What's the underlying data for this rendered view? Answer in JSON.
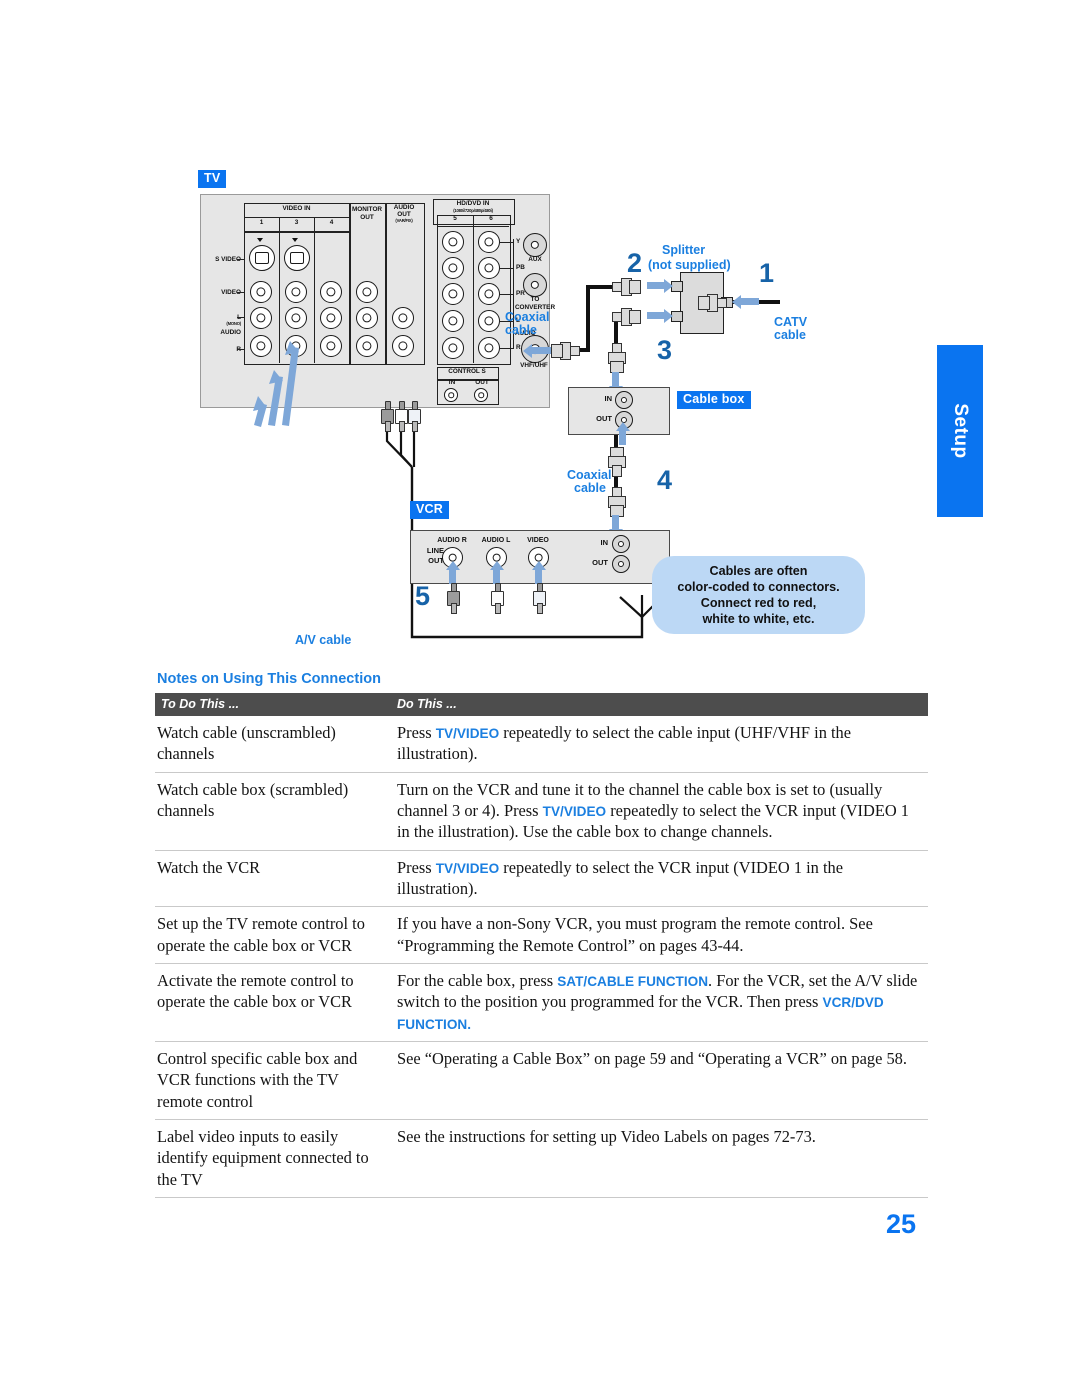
{
  "page": {
    "number": "25",
    "side_tab": "Setup"
  },
  "diagram": {
    "device_labels": {
      "tv": "TV",
      "cable_box": "Cable box",
      "vcr": "VCR"
    },
    "cable_labels": {
      "coax_tv": "Coaxial\ncable",
      "coax_tv_l1": "Coaxial",
      "coax_tv_l2": "cable",
      "catv_l1": "CATV",
      "catv_l2": "cable",
      "coax_vcr_l1": "Coaxial",
      "coax_vcr_l2": "cable",
      "av_cable": "A/V cable"
    },
    "splitter": {
      "title": "Splitter",
      "note": "(not supplied)"
    },
    "steps": [
      "1",
      "2",
      "3",
      "4",
      "5"
    ],
    "tv_panel": {
      "video_in": "VIDEO IN",
      "video_in_nums": [
        "1",
        "3",
        "4"
      ],
      "monitor_out_l1": "MONITOR",
      "monitor_out_l2": "OUT",
      "audio_out_l1": "AUDIO",
      "audio_out_l2": "OUT",
      "audio_out_sub": "(VAR/FIX)",
      "hd_dvd_in": "HD/DVD IN",
      "hd_dvd_sub": "(1080i/720p/480p/480i)",
      "hd_dvd_nums": [
        "5",
        "6"
      ],
      "row_labels_left": [
        "S VIDEO",
        "VIDEO",
        "L",
        "(MONO)",
        "AUDIO",
        "R"
      ],
      "hd_row_labels": [
        "Y",
        "PB",
        "PR",
        "L",
        "R"
      ],
      "hd_audio_label": "AUDIO",
      "aux": "AUX",
      "to_converter_l1": "TO",
      "to_converter_l2": "CONVERTER",
      "vhf_uhf": "VHF/UHF",
      "control_s": "CONTROL S",
      "control_in": "IN",
      "control_out": "OUT"
    },
    "cable_box_ports": {
      "in": "IN",
      "out": "OUT"
    },
    "vcr_panel": {
      "line_out_l1": "LINE",
      "line_out_l2": "OUT",
      "audio_r": "AUDIO R",
      "audio_l": "AUDIO L",
      "video": "VIDEO",
      "in": "IN",
      "out": "OUT"
    },
    "callout": {
      "line1": "Cables are often",
      "line2": "color-coded to connectors.",
      "line3": "Connect red to red,",
      "line4": "white to white, etc."
    },
    "colors": {
      "accent_blue": "#0a74f0",
      "label_blue": "#1b7fe0",
      "arrow_blue": "#7ea7d8",
      "callout_bg": "#bcd8f5"
    }
  },
  "notes": {
    "heading": "Notes on Using This Connection",
    "columns": [
      "To Do This ...",
      "Do This ..."
    ],
    "rows": [
      {
        "todo": "Watch cable (unscrambled) channels",
        "do_parts": [
          {
            "t": "Press "
          },
          {
            "t": "TV/VIDEO",
            "kw": true
          },
          {
            "t": " repeatedly to select the cable input (UHF/VHF in the illustration)."
          }
        ]
      },
      {
        "todo": "Watch cable box (scrambled) channels",
        "do_parts": [
          {
            "t": "Turn on the VCR and tune it to the channel the cable box is set to (usually channel 3 or 4). Press "
          },
          {
            "t": "TV/VIDEO",
            "kw": true
          },
          {
            "t": " repeatedly to select the VCR input (VIDEO 1 in the illustration). Use the cable box to change channels."
          }
        ]
      },
      {
        "todo": "Watch the VCR",
        "do_parts": [
          {
            "t": "Press "
          },
          {
            "t": "TV/VIDEO",
            "kw": true
          },
          {
            "t": " repeatedly to select the VCR input (VIDEO 1 in the illustration)."
          }
        ]
      },
      {
        "todo": "Set up the TV remote control to operate the cable box or VCR",
        "do_parts": [
          {
            "t": "If you have a non-Sony VCR, you must program the remote control. See “Programming the Remote Control” on pages 43-44."
          }
        ]
      },
      {
        "todo": "Activate the remote control to operate the cable box or VCR",
        "do_parts": [
          {
            "t": "For the cable box, press "
          },
          {
            "t": "SAT/CABLE FUNCTION",
            "kw": true
          },
          {
            "t": ". For the VCR, set the A/V slide switch to the position you programmed for the VCR. Then press "
          },
          {
            "t": "VCR/DVD FUNCTION.",
            "kw": true
          }
        ]
      },
      {
        "todo": "Control specific cable box and VCR functions with the TV remote control",
        "do_parts": [
          {
            "t": "See “Operating a Cable Box” on page 59 and “Operating a VCR” on page 58."
          }
        ]
      },
      {
        "todo": "Label video inputs to easily identify equipment connected to the TV",
        "do_parts": [
          {
            "t": "See the instructions for setting up Video Labels on pages 72-73."
          }
        ]
      }
    ]
  }
}
